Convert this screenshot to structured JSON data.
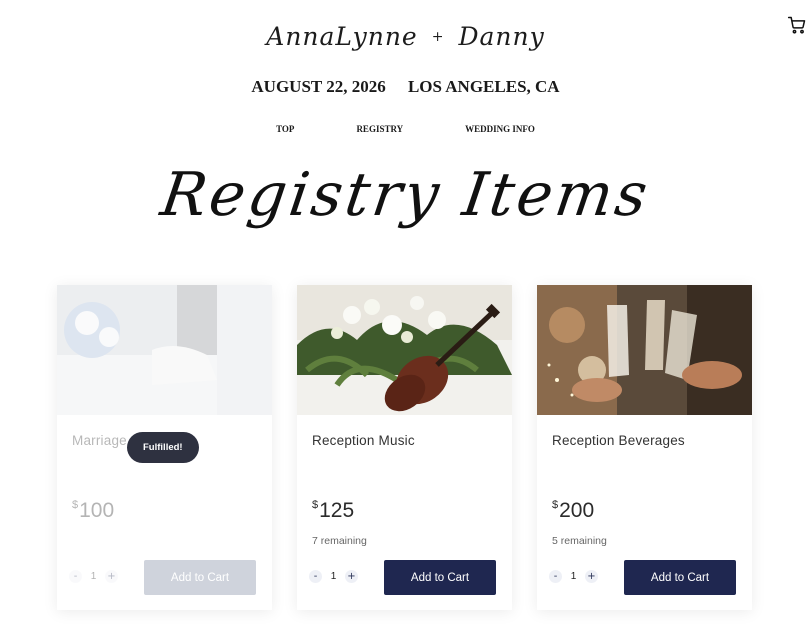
{
  "header": {
    "bride": "AnnaLynne",
    "plus": "+",
    "groom": "Danny",
    "date": "AUGUST 22, 2026",
    "location": "LOS ANGELES, CA",
    "cart_icon": "shopping-cart-icon"
  },
  "nav": {
    "items": [
      "TOP",
      "REGISTRY",
      "WEDDING INFO"
    ]
  },
  "hero": {
    "title": "Registry Items"
  },
  "products": [
    {
      "title": "Marriage",
      "currency": "$",
      "price": "100",
      "remaining": "",
      "qty": "1",
      "minus": "-",
      "plus": "+",
      "button": "Add to Cart",
      "badge": "Fulfilled!"
    },
    {
      "title": "Reception Music",
      "currency": "$",
      "price": "125",
      "remaining": "7 remaining",
      "qty": "1",
      "minus": "-",
      "plus": "+",
      "button": "Add to Cart"
    },
    {
      "title": "Reception Beverages",
      "currency": "$",
      "price": "200",
      "remaining": "5 remaining",
      "qty": "1",
      "minus": "-",
      "plus": "+",
      "button": "Add to Cart"
    }
  ],
  "colors": {
    "button": "#1f2750",
    "badge": "#2e3140"
  }
}
